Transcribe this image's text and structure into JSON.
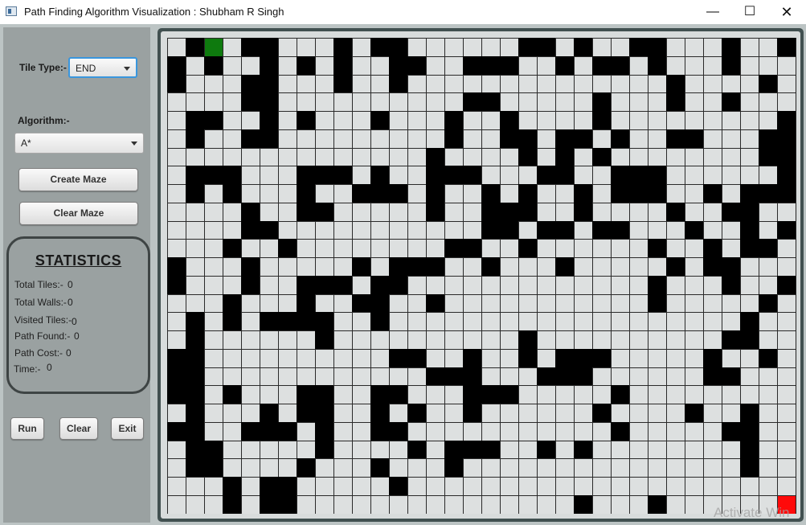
{
  "window": {
    "title": "Path Finding Algorithm Visualization : Shubham R Singh",
    "minimize_glyph": "—",
    "maximize_glyph": "☐",
    "close_glyph": "✕"
  },
  "controls": {
    "tile_type_label": "Tile Type:-",
    "tile_type_value": "END",
    "algorithm_label": "Algorithm:-",
    "algorithm_value": "A*",
    "create_maze_label": "Create Maze",
    "clear_maze_label": "Clear Maze",
    "run_label": "Run",
    "clear_label": "Clear",
    "exit_label": "Exit"
  },
  "statistics": {
    "title": "STATISTICS",
    "items": [
      {
        "label": "Total Tiles:-",
        "value": "0"
      },
      {
        "label": "Total Walls:-",
        "value": "0"
      },
      {
        "label": "Visited Tiles:-",
        "value": "0"
      },
      {
        "label": "Path Found:-",
        "value": "0"
      },
      {
        "label": "Path Cost:-",
        "value": "0"
      },
      {
        "label": "Time:-",
        "value": "0"
      }
    ]
  },
  "grid": {
    "cols": 34,
    "rows": 26,
    "legend": {
      ".": "empty",
      "#": "wall",
      "S": "start",
      "E": "end"
    },
    "cells": [
      ".#S.##...#.##......##.#..##...#..#",
      "#.#..#.#.#..##..###..#.##.#...#...",
      "#...##...#..#..............#....#.",
      "....##..........##.....#...#..#...",
      ".##..#.#...#...#..#....#.........#",
      ".#..##.........#..##.##.#..##...##",
      "..............#....#.#.#........##",
      ".###...###.#..###...##..###......#",
      ".#.#...#..###.#..#.#..#.###..#.###",
      "....#..##.....#..###..#....#..##..",
      "....##...........##.##.##...#..#.#",
      "...#..#........##..#......#..#.##.",
      "#...#.....#.###..#...#.....#.##...",
      "#...#..###.##.............#...#..#",
      "...#...#..##..#...........#.....#.",
      ".#.#.####..#...................#..",
      ".#......#..........#..........##..",
      "##..........##..#..#.###.....#..#.",
      "##............###...###......##...",
      "##.#...##..##...###.....#.........",
      ".#...#.##..#.#..#......#....#..#..",
      "##..###.#..##...........#.....##..",
      ".##.....#....#.###..#.#........#..",
      ".##....#...#...#...............#..",
      "...#.##.....#.....................",
      "...#.##...............#...#......E"
    ]
  },
  "watermark": "Activate Win"
}
